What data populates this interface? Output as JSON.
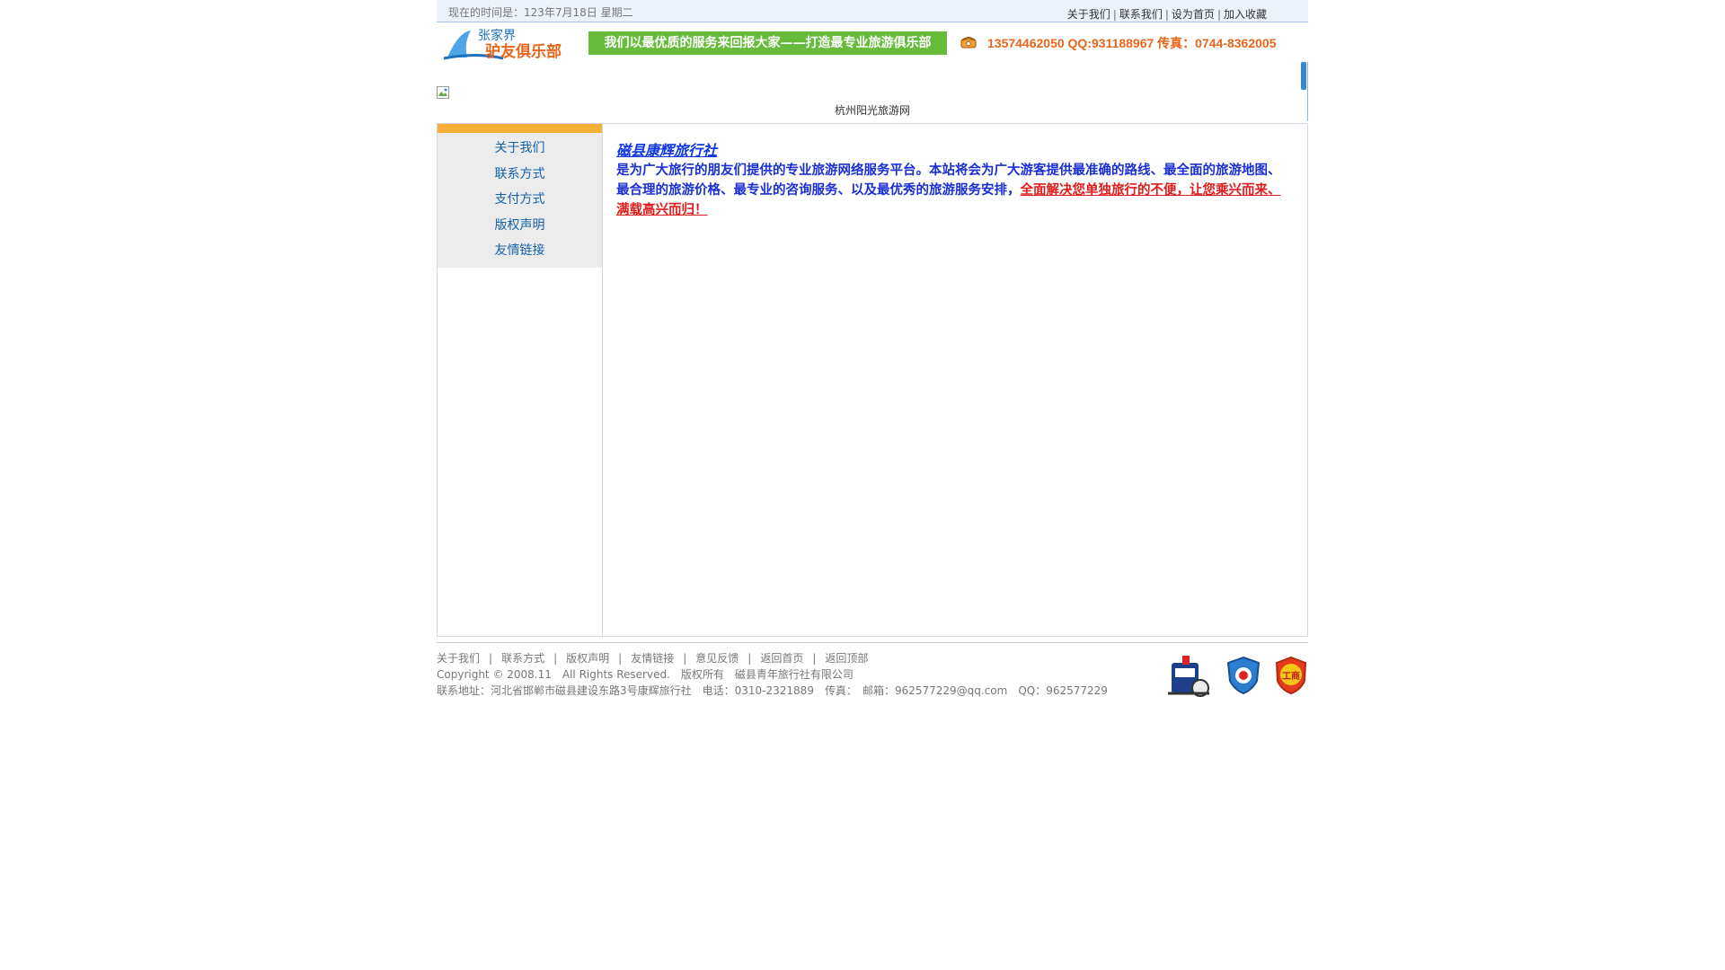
{
  "topbar": {
    "time_text": "现在的时间是：123年7月18日 星期二",
    "links": [
      "关于我们",
      "联系我们",
      "设为首页",
      "加入收藏"
    ]
  },
  "header": {
    "logo_line1": "张家界",
    "logo_line2": "驴友俱乐部",
    "slogan": "我们以最优质的服务来回报大家——打造最专业旅游俱乐部",
    "contact": "13574462050  QQ:931188967 传真：0744-8362005"
  },
  "banner": {
    "caption": "杭州阳光旅游网"
  },
  "sidebar": {
    "items": [
      "关于我们",
      "联系方式",
      "支付方式",
      "版权声明",
      "友情链接"
    ]
  },
  "content": {
    "title": "磁县康辉旅行社",
    "desc_blue": "是为广大旅行的朋友们提供的专业旅游网络服务平台。本站将会为广大游客提供最准确的路线、最全面的旅游地图、最合理的旅游价格、最专业的咨询服务、以及最优秀的旅游服务安排，",
    "desc_red": "全面解决您单独旅行的不便，让您乘兴而来、满载高兴而归！"
  },
  "footer": {
    "nav": [
      "关于我们",
      "联系方式",
      "版权声明",
      "友情链接",
      "意见反馈",
      "返回首页",
      "返回顶部"
    ],
    "copyright": "Copyright © 2008.11　All Rights Reserved.　版权所有　磁县青年旅行社有限公司",
    "address": "联系地址：河北省邯郸市磁县建设东路3号康辉旅行社　电话：0310-2321889　传真：　邮箱：962577229@qq.com　QQ：962577229",
    "badge3_char": "工商"
  },
  "colors": {
    "accent_green": "#67bb3a",
    "accent_orange": "#f7b036",
    "link_blue": "#1460a8",
    "title_blue": "#1037e0",
    "highlight_red": "#e01b1b"
  }
}
